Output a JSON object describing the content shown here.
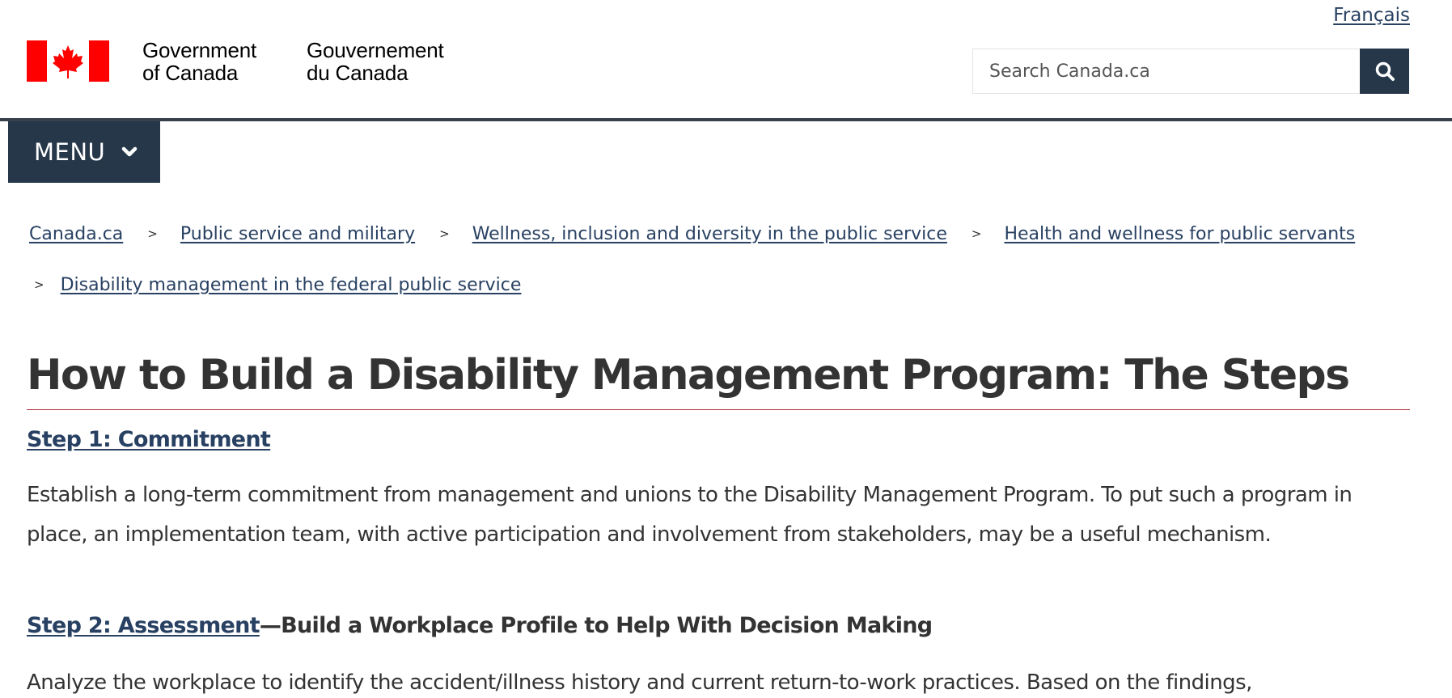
{
  "header": {
    "language_toggle": "Français",
    "wordmark_en_line1": "Government",
    "wordmark_en_line2": "of Canada",
    "wordmark_fr_line1": "Gouvernement",
    "wordmark_fr_line2": "du Canada",
    "search_placeholder": "Search Canada.ca",
    "search_button_icon": "search-icon"
  },
  "menu": {
    "label": "MENU",
    "icon": "chevron-down-icon"
  },
  "breadcrumb": [
    {
      "label": "Canada.ca"
    },
    {
      "label": "Public service and military"
    },
    {
      "label": "Wellness, inclusion and diversity in the public service"
    },
    {
      "label": "Health and wellness for public servants"
    },
    {
      "label": "Disability management in the federal public service"
    }
  ],
  "breadcrumb_separator": ">",
  "main": {
    "title": "How to Build a Disability Management Program: The Steps",
    "steps": [
      {
        "link": "Step 1: Commitment",
        "suffix": "",
        "body": "Establish a long-term commitment from management and unions to the Disability Management Program. To put such a program in place, an implementation team, with active participation and involvement from stakeholders, may be a useful mechanism."
      },
      {
        "link": "Step 2: Assessment",
        "suffix": "—Build a Workplace Profile to Help With Decision Making",
        "body": "Analyze the workplace to identify the accident/illness history and current return-to-work practices. Based on the findings,"
      }
    ]
  },
  "colors": {
    "link": "#284162",
    "dark_navy": "#26374a",
    "header_rule": "#38414d",
    "title_rule": "#af3c43",
    "flag_red": "#ff0000",
    "text": "#333333"
  }
}
